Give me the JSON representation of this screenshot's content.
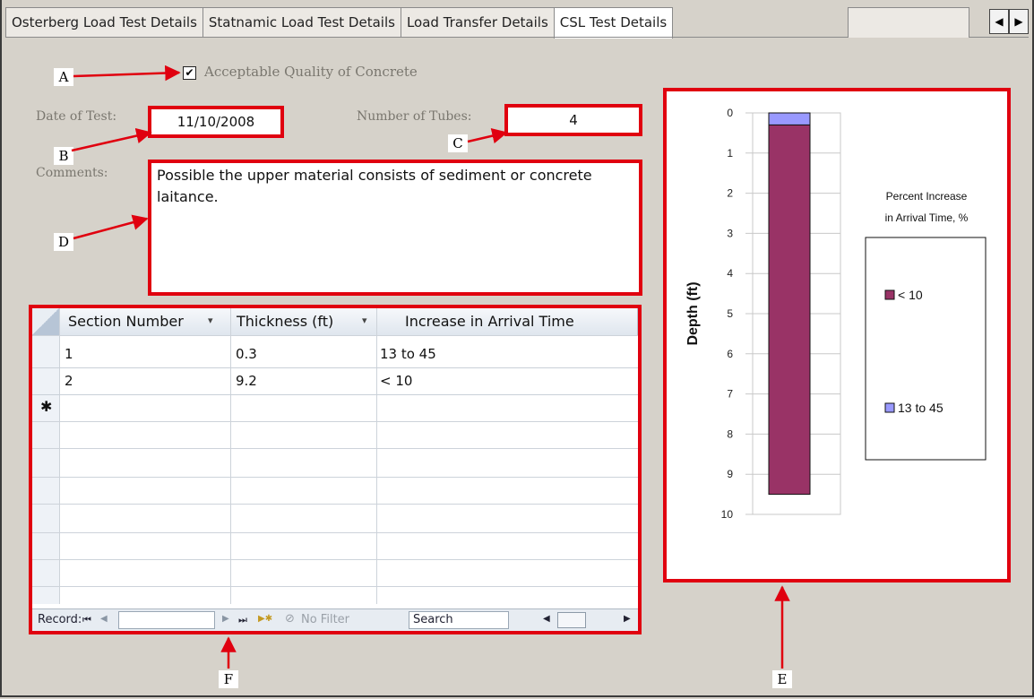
{
  "tabs": [
    {
      "label": "Osterberg Load Test Details"
    },
    {
      "label": "Statnamic Load Test Details"
    },
    {
      "label": "Load Transfer Details"
    },
    {
      "label": "CSL Test Details"
    }
  ],
  "scroll": {
    "left": "◀",
    "right": "▶"
  },
  "callouts": {
    "a": "A",
    "b": "B",
    "c": "C",
    "d": "D",
    "e": "E",
    "f": "F"
  },
  "form": {
    "quality_label": "Acceptable Quality of Concrete",
    "quality_checked": true,
    "check_mark": "✔",
    "date_label": "Date of Test:",
    "date_value": "11/10/2008",
    "tubes_label": "Number of Tubes:",
    "tubes_value": "4",
    "comments_label": "Comments:",
    "comments_value": "Possible the upper material consists of sediment or concrete laitance."
  },
  "table": {
    "columns": [
      "Section Number",
      "Thickness (ft)",
      "Increase in Arrival Time"
    ],
    "sort_glyph": "▾",
    "rows": [
      {
        "section": "1",
        "thickness": "0.3",
        "increase": "13 to 45"
      },
      {
        "section": "2",
        "thickness": "9.2",
        "increase": "< 10"
      }
    ],
    "new_row_marker": "✱",
    "nav": {
      "record_label": "Record:",
      "first": "⏮",
      "prev": "◀",
      "next": "▶",
      "last": "⏭",
      "new": "▶✱",
      "no_filter": "No Filter",
      "search": "Search"
    }
  },
  "chart_data": {
    "type": "bar",
    "orientation": "vertical-stacked-depth",
    "ylabel": "Depth (ft)",
    "ylim": [
      0,
      10
    ],
    "y_ticks": [
      "0",
      "1",
      "2",
      "3",
      "4",
      "5",
      "6",
      "7",
      "8",
      "9",
      "10"
    ],
    "legend_title_line1": "Percent Increase",
    "legend_title_line2": "in Arrival Time, %",
    "series": [
      {
        "name": "13 to 45",
        "from": 0,
        "to": 0.3,
        "color": "#9999ff"
      },
      {
        "name": "< 10",
        "from": 0.3,
        "to": 9.5,
        "color": "#993366"
      }
    ],
    "grid": true
  },
  "colors": {
    "annotation": "#e0000f"
  }
}
